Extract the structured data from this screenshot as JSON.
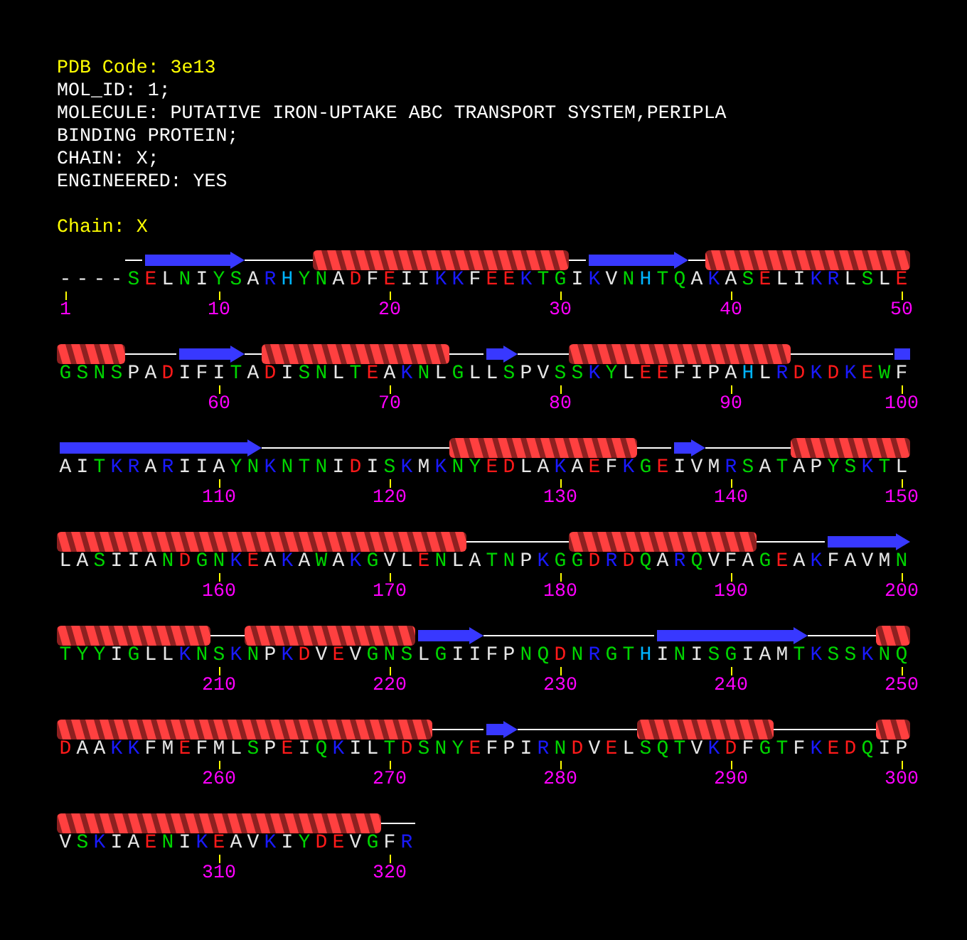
{
  "pdb_code": "PDB Code: 3e13",
  "header_lines": [
    "MOL_ID: 1;",
    "MOLECULE: PUTATIVE IRON-UPTAKE ABC TRANSPORT SYSTEM,PERIPLA",
    "BINDING PROTEIN;",
    "CHAIN: X;",
    "ENGINEERED: YES"
  ],
  "chain_label": "Chain: X",
  "rows": [
    {
      "segments": [
        {
          "kind": "none",
          "residues": [
            {
              "letter": "-",
              "color": "#e6e6e6",
              "number": "1"
            },
            {
              "letter": "-",
              "color": "#e6e6e6"
            },
            {
              "letter": "-",
              "color": "#e6e6e6"
            },
            {
              "letter": "-",
              "color": "#e6e6e6"
            }
          ]
        },
        {
          "kind": "coil",
          "residues": [
            {
              "letter": "S",
              "color": "#00d400"
            }
          ]
        },
        {
          "kind": "strand",
          "residues": [
            {
              "letter": "E",
              "color": "#ff1a1a"
            },
            {
              "letter": "L",
              "color": "#e6e6e6"
            },
            {
              "letter": "N",
              "color": "#00d400"
            },
            {
              "letter": "I",
              "color": "#e6e6e6"
            },
            {
              "letter": "Y",
              "color": "#00d400",
              "number": "10"
            },
            {
              "letter": "S",
              "color": "#00d400"
            }
          ]
        },
        {
          "kind": "coil",
          "residues": [
            {
              "letter": "A",
              "color": "#e6e6e6"
            },
            {
              "letter": "R",
              "color": "#1a1aff"
            },
            {
              "letter": "H",
              "color": "#00b4ff"
            },
            {
              "letter": "Y",
              "color": "#00d400"
            }
          ]
        },
        {
          "kind": "helix",
          "residues": [
            {
              "letter": "N",
              "color": "#00d400"
            },
            {
              "letter": "A",
              "color": "#e6e6e6"
            },
            {
              "letter": "D",
              "color": "#ff1a1a"
            },
            {
              "letter": "F",
              "color": "#e6e6e6"
            },
            {
              "letter": "E",
              "color": "#ff1a1a",
              "number": "20"
            },
            {
              "letter": "I",
              "color": "#e6e6e6"
            },
            {
              "letter": "I",
              "color": "#e6e6e6"
            },
            {
              "letter": "K",
              "color": "#1a1aff"
            },
            {
              "letter": "K",
              "color": "#1a1aff"
            },
            {
              "letter": "F",
              "color": "#e6e6e6"
            },
            {
              "letter": "E",
              "color": "#ff1a1a"
            },
            {
              "letter": "E",
              "color": "#ff1a1a"
            },
            {
              "letter": "K",
              "color": "#1a1aff"
            },
            {
              "letter": "T",
              "color": "#00d400"
            },
            {
              "letter": "G",
              "color": "#00d400",
              "number": "30"
            }
          ]
        },
        {
          "kind": "coil",
          "residues": [
            {
              "letter": "I",
              "color": "#e6e6e6"
            }
          ]
        },
        {
          "kind": "strand",
          "residues": [
            {
              "letter": "K",
              "color": "#1a1aff"
            },
            {
              "letter": "V",
              "color": "#e6e6e6"
            },
            {
              "letter": "N",
              "color": "#00d400"
            },
            {
              "letter": "H",
              "color": "#00b4ff"
            },
            {
              "letter": "T",
              "color": "#00d400"
            },
            {
              "letter": "Q",
              "color": "#00d400"
            }
          ]
        },
        {
          "kind": "coil",
          "residues": [
            {
              "letter": "A",
              "color": "#e6e6e6"
            }
          ]
        },
        {
          "kind": "helix",
          "residues": [
            {
              "letter": "K",
              "color": "#1a1aff"
            },
            {
              "letter": "A",
              "color": "#e6e6e6",
              "number": "40"
            },
            {
              "letter": "S",
              "color": "#00d400"
            },
            {
              "letter": "E",
              "color": "#ff1a1a"
            },
            {
              "letter": "L",
              "color": "#e6e6e6"
            },
            {
              "letter": "I",
              "color": "#e6e6e6"
            },
            {
              "letter": "K",
              "color": "#1a1aff"
            },
            {
              "letter": "R",
              "color": "#1a1aff"
            },
            {
              "letter": "L",
              "color": "#e6e6e6"
            },
            {
              "letter": "S",
              "color": "#00d400"
            },
            {
              "letter": "L",
              "color": "#e6e6e6"
            },
            {
              "letter": "E",
              "color": "#ff1a1a",
              "number": "50"
            }
          ]
        }
      ]
    },
    {
      "segments": [
        {
          "kind": "helix",
          "residues": [
            {
              "letter": "G",
              "color": "#00d400"
            },
            {
              "letter": "S",
              "color": "#00d400"
            },
            {
              "letter": "N",
              "color": "#00d400"
            },
            {
              "letter": "S",
              "color": "#00d400"
            }
          ]
        },
        {
          "kind": "coil",
          "residues": [
            {
              "letter": "P",
              "color": "#e6e6e6"
            },
            {
              "letter": "A",
              "color": "#e6e6e6"
            },
            {
              "letter": "D",
              "color": "#ff1a1a"
            }
          ]
        },
        {
          "kind": "strand",
          "residues": [
            {
              "letter": "I",
              "color": "#e6e6e6"
            },
            {
              "letter": "F",
              "color": "#e6e6e6"
            },
            {
              "letter": "I",
              "color": "#e6e6e6",
              "number": "60"
            },
            {
              "letter": "T",
              "color": "#00d400"
            }
          ]
        },
        {
          "kind": "coil",
          "residues": [
            {
              "letter": "A",
              "color": "#e6e6e6"
            }
          ]
        },
        {
          "kind": "helix",
          "residues": [
            {
              "letter": "D",
              "color": "#ff1a1a"
            },
            {
              "letter": "I",
              "color": "#e6e6e6"
            },
            {
              "letter": "S",
              "color": "#00d400"
            },
            {
              "letter": "N",
              "color": "#00d400"
            },
            {
              "letter": "L",
              "color": "#e6e6e6"
            },
            {
              "letter": "T",
              "color": "#00d400"
            },
            {
              "letter": "E",
              "color": "#ff1a1a"
            },
            {
              "letter": "A",
              "color": "#e6e6e6",
              "number": "70"
            },
            {
              "letter": "K",
              "color": "#1a1aff"
            },
            {
              "letter": "N",
              "color": "#00d400"
            },
            {
              "letter": "L",
              "color": "#e6e6e6"
            }
          ]
        },
        {
          "kind": "coil",
          "residues": [
            {
              "letter": "G",
              "color": "#00d400"
            },
            {
              "letter": "L",
              "color": "#e6e6e6"
            }
          ]
        },
        {
          "kind": "strand",
          "residues": [
            {
              "letter": "L",
              "color": "#e6e6e6"
            },
            {
              "letter": "S",
              "color": "#00d400"
            }
          ]
        },
        {
          "kind": "coil",
          "residues": [
            {
              "letter": "P",
              "color": "#e6e6e6"
            },
            {
              "letter": "V",
              "color": "#e6e6e6"
            },
            {
              "letter": "S",
              "color": "#00d400",
              "number": "80"
            }
          ]
        },
        {
          "kind": "helix",
          "residues": [
            {
              "letter": "S",
              "color": "#00d400"
            },
            {
              "letter": "K",
              "color": "#1a1aff"
            },
            {
              "letter": "Y",
              "color": "#00d400"
            },
            {
              "letter": "L",
              "color": "#e6e6e6"
            },
            {
              "letter": "E",
              "color": "#ff1a1a"
            },
            {
              "letter": "E",
              "color": "#ff1a1a"
            },
            {
              "letter": "F",
              "color": "#e6e6e6"
            },
            {
              "letter": "I",
              "color": "#e6e6e6"
            },
            {
              "letter": "P",
              "color": "#e6e6e6"
            },
            {
              "letter": "A",
              "color": "#e6e6e6",
              "number": "90"
            },
            {
              "letter": "H",
              "color": "#00b4ff"
            },
            {
              "letter": "L",
              "color": "#e6e6e6"
            },
            {
              "letter": "R",
              "color": "#1a1aff"
            }
          ]
        },
        {
          "kind": "coil",
          "residues": [
            {
              "letter": "D",
              "color": "#ff1a1a"
            },
            {
              "letter": "K",
              "color": "#1a1aff"
            },
            {
              "letter": "D",
              "color": "#ff1a1a"
            },
            {
              "letter": "K",
              "color": "#1a1aff"
            },
            {
              "letter": "E",
              "color": "#ff1a1a"
            },
            {
              "letter": "W",
              "color": "#00d400"
            }
          ]
        },
        {
          "kind": "strand",
          "residues": [
            {
              "letter": "F",
              "color": "#e6e6e6",
              "number": "100"
            }
          ]
        }
      ]
    },
    {
      "segments": [
        {
          "kind": "strand",
          "residues": [
            {
              "letter": "A",
              "color": "#e6e6e6"
            },
            {
              "letter": "I",
              "color": "#e6e6e6"
            },
            {
              "letter": "T",
              "color": "#00d400"
            },
            {
              "letter": "K",
              "color": "#1a1aff"
            },
            {
              "letter": "R",
              "color": "#1a1aff"
            },
            {
              "letter": "A",
              "color": "#e6e6e6"
            },
            {
              "letter": "R",
              "color": "#1a1aff"
            },
            {
              "letter": "I",
              "color": "#e6e6e6"
            },
            {
              "letter": "I",
              "color": "#e6e6e6"
            },
            {
              "letter": "A",
              "color": "#e6e6e6",
              "number": "110"
            },
            {
              "letter": "Y",
              "color": "#00d400"
            },
            {
              "letter": "N",
              "color": "#00d400"
            }
          ]
        },
        {
          "kind": "coil",
          "residues": [
            {
              "letter": "K",
              "color": "#1a1aff"
            },
            {
              "letter": "N",
              "color": "#00d400"
            },
            {
              "letter": "T",
              "color": "#00d400"
            },
            {
              "letter": "N",
              "color": "#00d400"
            },
            {
              "letter": "I",
              "color": "#e6e6e6"
            },
            {
              "letter": "D",
              "color": "#ff1a1a"
            },
            {
              "letter": "I",
              "color": "#e6e6e6"
            },
            {
              "letter": "S",
              "color": "#00d400",
              "number": "120"
            },
            {
              "letter": "K",
              "color": "#1a1aff"
            },
            {
              "letter": "M",
              "color": "#e6e6e6"
            },
            {
              "letter": "K",
              "color": "#1a1aff"
            }
          ]
        },
        {
          "kind": "helix",
          "residues": [
            {
              "letter": "N",
              "color": "#00d400"
            },
            {
              "letter": "Y",
              "color": "#00d400"
            },
            {
              "letter": "E",
              "color": "#ff1a1a"
            },
            {
              "letter": "D",
              "color": "#ff1a1a"
            },
            {
              "letter": "L",
              "color": "#e6e6e6"
            },
            {
              "letter": "A",
              "color": "#e6e6e6"
            },
            {
              "letter": "K",
              "color": "#1a1aff",
              "number": "130"
            },
            {
              "letter": "A",
              "color": "#e6e6e6"
            },
            {
              "letter": "E",
              "color": "#ff1a1a"
            },
            {
              "letter": "F",
              "color": "#e6e6e6"
            },
            {
              "letter": "K",
              "color": "#1a1aff"
            }
          ]
        },
        {
          "kind": "coil",
          "residues": [
            {
              "letter": "G",
              "color": "#00d400"
            },
            {
              "letter": "E",
              "color": "#ff1a1a"
            }
          ]
        },
        {
          "kind": "strand",
          "residues": [
            {
              "letter": "I",
              "color": "#e6e6e6"
            },
            {
              "letter": "V",
              "color": "#e6e6e6"
            }
          ]
        },
        {
          "kind": "coil",
          "residues": [
            {
              "letter": "M",
              "color": "#e6e6e6"
            },
            {
              "letter": "R",
              "color": "#1a1aff",
              "number": "140"
            },
            {
              "letter": "S",
              "color": "#00d400"
            },
            {
              "letter": "A",
              "color": "#e6e6e6"
            },
            {
              "letter": "T",
              "color": "#00d400"
            }
          ]
        },
        {
          "kind": "helix",
          "residues": [
            {
              "letter": "A",
              "color": "#e6e6e6"
            },
            {
              "letter": "P",
              "color": "#e6e6e6"
            },
            {
              "letter": "Y",
              "color": "#00d400"
            },
            {
              "letter": "S",
              "color": "#00d400"
            },
            {
              "letter": "K",
              "color": "#1a1aff"
            },
            {
              "letter": "T",
              "color": "#00d400"
            },
            {
              "letter": "L",
              "color": "#e6e6e6",
              "number": "150"
            }
          ]
        }
      ]
    },
    {
      "segments": [
        {
          "kind": "helix",
          "residues": [
            {
              "letter": "L",
              "color": "#e6e6e6"
            },
            {
              "letter": "A",
              "color": "#e6e6e6"
            },
            {
              "letter": "S",
              "color": "#00d400"
            },
            {
              "letter": "I",
              "color": "#e6e6e6"
            },
            {
              "letter": "I",
              "color": "#e6e6e6"
            },
            {
              "letter": "A",
              "color": "#e6e6e6"
            },
            {
              "letter": "N",
              "color": "#00d400"
            },
            {
              "letter": "D",
              "color": "#ff1a1a"
            },
            {
              "letter": "G",
              "color": "#00d400"
            },
            {
              "letter": "N",
              "color": "#00d400",
              "number": "160"
            },
            {
              "letter": "K",
              "color": "#1a1aff"
            },
            {
              "letter": "E",
              "color": "#ff1a1a"
            },
            {
              "letter": "A",
              "color": "#e6e6e6"
            },
            {
              "letter": "K",
              "color": "#1a1aff"
            },
            {
              "letter": "A",
              "color": "#e6e6e6"
            },
            {
              "letter": "W",
              "color": "#00d400"
            },
            {
              "letter": "A",
              "color": "#e6e6e6"
            },
            {
              "letter": "K",
              "color": "#1a1aff"
            },
            {
              "letter": "G",
              "color": "#00d400"
            },
            {
              "letter": "V",
              "color": "#e6e6e6",
              "number": "170"
            },
            {
              "letter": "L",
              "color": "#e6e6e6"
            },
            {
              "letter": "E",
              "color": "#ff1a1a"
            },
            {
              "letter": "N",
              "color": "#00d400"
            },
            {
              "letter": "L",
              "color": "#e6e6e6"
            }
          ]
        },
        {
          "kind": "coil",
          "residues": [
            {
              "letter": "A",
              "color": "#e6e6e6"
            },
            {
              "letter": "T",
              "color": "#00d400"
            },
            {
              "letter": "N",
              "color": "#00d400"
            },
            {
              "letter": "P",
              "color": "#e6e6e6"
            },
            {
              "letter": "K",
              "color": "#1a1aff"
            },
            {
              "letter": "G",
              "color": "#00d400",
              "number": "180"
            }
          ]
        },
        {
          "kind": "helix",
          "residues": [
            {
              "letter": "G",
              "color": "#00d400"
            },
            {
              "letter": "D",
              "color": "#ff1a1a"
            },
            {
              "letter": "R",
              "color": "#1a1aff"
            },
            {
              "letter": "D",
              "color": "#ff1a1a"
            },
            {
              "letter": "Q",
              "color": "#00d400"
            },
            {
              "letter": "A",
              "color": "#e6e6e6"
            },
            {
              "letter": "R",
              "color": "#1a1aff"
            },
            {
              "letter": "Q",
              "color": "#00d400"
            },
            {
              "letter": "V",
              "color": "#e6e6e6"
            },
            {
              "letter": "F",
              "color": "#e6e6e6",
              "number": "190"
            },
            {
              "letter": "A",
              "color": "#e6e6e6"
            }
          ]
        },
        {
          "kind": "coil",
          "residues": [
            {
              "letter": "G",
              "color": "#00d400"
            },
            {
              "letter": "E",
              "color": "#ff1a1a"
            },
            {
              "letter": "A",
              "color": "#e6e6e6"
            },
            {
              "letter": "K",
              "color": "#1a1aff"
            }
          ]
        },
        {
          "kind": "strand",
          "residues": [
            {
              "letter": "F",
              "color": "#e6e6e6"
            },
            {
              "letter": "A",
              "color": "#e6e6e6"
            },
            {
              "letter": "V",
              "color": "#e6e6e6"
            },
            {
              "letter": "M",
              "color": "#e6e6e6"
            },
            {
              "letter": "N",
              "color": "#00d400",
              "number": "200"
            }
          ]
        }
      ]
    },
    {
      "segments": [
        {
          "kind": "helix",
          "residues": [
            {
              "letter": "T",
              "color": "#00d400"
            },
            {
              "letter": "Y",
              "color": "#00d400"
            },
            {
              "letter": "Y",
              "color": "#00d400"
            },
            {
              "letter": "I",
              "color": "#e6e6e6"
            },
            {
              "letter": "G",
              "color": "#00d400"
            },
            {
              "letter": "L",
              "color": "#e6e6e6"
            },
            {
              "letter": "L",
              "color": "#e6e6e6"
            },
            {
              "letter": "K",
              "color": "#1a1aff"
            },
            {
              "letter": "N",
              "color": "#00d400"
            }
          ]
        },
        {
          "kind": "coil",
          "residues": [
            {
              "letter": "S",
              "color": "#00d400",
              "number": "210"
            },
            {
              "letter": "K",
              "color": "#1a1aff"
            }
          ]
        },
        {
          "kind": "helix",
          "residues": [
            {
              "letter": "N",
              "color": "#00d400"
            },
            {
              "letter": "P",
              "color": "#e6e6e6"
            },
            {
              "letter": "K",
              "color": "#1a1aff"
            },
            {
              "letter": "D",
              "color": "#ff1a1a"
            },
            {
              "letter": "V",
              "color": "#e6e6e6"
            },
            {
              "letter": "E",
              "color": "#ff1a1a"
            },
            {
              "letter": "V",
              "color": "#e6e6e6"
            },
            {
              "letter": "G",
              "color": "#00d400"
            },
            {
              "letter": "N",
              "color": "#00d400",
              "number": "220"
            },
            {
              "letter": "S",
              "color": "#00d400"
            }
          ]
        },
        {
          "kind": "strand",
          "residues": [
            {
              "letter": "L",
              "color": "#e6e6e6"
            },
            {
              "letter": "G",
              "color": "#00d400"
            },
            {
              "letter": "I",
              "color": "#e6e6e6"
            },
            {
              "letter": "I",
              "color": "#e6e6e6"
            }
          ]
        },
        {
          "kind": "coil",
          "residues": [
            {
              "letter": "F",
              "color": "#e6e6e6"
            },
            {
              "letter": "P",
              "color": "#e6e6e6"
            },
            {
              "letter": "N",
              "color": "#00d400"
            },
            {
              "letter": "Q",
              "color": "#00d400"
            },
            {
              "letter": "D",
              "color": "#ff1a1a",
              "number": "230"
            },
            {
              "letter": "N",
              "color": "#00d400"
            },
            {
              "letter": "R",
              "color": "#1a1aff"
            },
            {
              "letter": "G",
              "color": "#00d400"
            },
            {
              "letter": "T",
              "color": "#00d400"
            },
            {
              "letter": "H",
              "color": "#00b4ff"
            }
          ]
        },
        {
          "kind": "strand",
          "residues": [
            {
              "letter": "I",
              "color": "#e6e6e6"
            },
            {
              "letter": "N",
              "color": "#00d400"
            },
            {
              "letter": "I",
              "color": "#e6e6e6"
            },
            {
              "letter": "S",
              "color": "#00d400"
            },
            {
              "letter": "G",
              "color": "#00d400",
              "number": "240"
            },
            {
              "letter": "I",
              "color": "#e6e6e6"
            },
            {
              "letter": "A",
              "color": "#e6e6e6"
            },
            {
              "letter": "M",
              "color": "#e6e6e6"
            },
            {
              "letter": "T",
              "color": "#00d400"
            }
          ]
        },
        {
          "kind": "coil",
          "residues": [
            {
              "letter": "K",
              "color": "#1a1aff"
            },
            {
              "letter": "S",
              "color": "#00d400"
            },
            {
              "letter": "S",
              "color": "#00d400"
            },
            {
              "letter": "K",
              "color": "#1a1aff"
            }
          ]
        },
        {
          "kind": "helix",
          "residues": [
            {
              "letter": "N",
              "color": "#00d400"
            },
            {
              "letter": "Q",
              "color": "#00d400",
              "number": "250"
            }
          ]
        }
      ]
    },
    {
      "segments": [
        {
          "kind": "helix",
          "residues": [
            {
              "letter": "D",
              "color": "#ff1a1a"
            },
            {
              "letter": "A",
              "color": "#e6e6e6"
            },
            {
              "letter": "A",
              "color": "#e6e6e6"
            },
            {
              "letter": "K",
              "color": "#1a1aff"
            },
            {
              "letter": "K",
              "color": "#1a1aff"
            },
            {
              "letter": "F",
              "color": "#e6e6e6"
            },
            {
              "letter": "M",
              "color": "#e6e6e6"
            },
            {
              "letter": "E",
              "color": "#ff1a1a"
            },
            {
              "letter": "F",
              "color": "#e6e6e6"
            },
            {
              "letter": "M",
              "color": "#e6e6e6",
              "number": "260"
            },
            {
              "letter": "L",
              "color": "#e6e6e6"
            },
            {
              "letter": "S",
              "color": "#00d400"
            },
            {
              "letter": "P",
              "color": "#e6e6e6"
            },
            {
              "letter": "E",
              "color": "#ff1a1a"
            },
            {
              "letter": "I",
              "color": "#e6e6e6"
            },
            {
              "letter": "Q",
              "color": "#00d400"
            },
            {
              "letter": "K",
              "color": "#1a1aff"
            },
            {
              "letter": "I",
              "color": "#e6e6e6"
            },
            {
              "letter": "L",
              "color": "#e6e6e6"
            },
            {
              "letter": "T",
              "color": "#00d400",
              "number": "270"
            },
            {
              "letter": "D",
              "color": "#ff1a1a"
            },
            {
              "letter": "S",
              "color": "#00d400"
            }
          ]
        },
        {
          "kind": "coil",
          "residues": [
            {
              "letter": "N",
              "color": "#00d400"
            },
            {
              "letter": "Y",
              "color": "#00d400"
            },
            {
              "letter": "E",
              "color": "#ff1a1a"
            }
          ]
        },
        {
          "kind": "strand",
          "residues": [
            {
              "letter": "F",
              "color": "#e6e6e6"
            },
            {
              "letter": "P",
              "color": "#e6e6e6"
            }
          ]
        },
        {
          "kind": "coil",
          "residues": [
            {
              "letter": "I",
              "color": "#e6e6e6"
            },
            {
              "letter": "R",
              "color": "#1a1aff"
            },
            {
              "letter": "N",
              "color": "#00d400",
              "number": "280"
            },
            {
              "letter": "D",
              "color": "#ff1a1a"
            },
            {
              "letter": "V",
              "color": "#e6e6e6"
            },
            {
              "letter": "E",
              "color": "#ff1a1a"
            },
            {
              "letter": "L",
              "color": "#e6e6e6"
            }
          ]
        },
        {
          "kind": "helix",
          "residues": [
            {
              "letter": "S",
              "color": "#00d400"
            },
            {
              "letter": "Q",
              "color": "#00d400"
            },
            {
              "letter": "T",
              "color": "#00d400"
            },
            {
              "letter": "V",
              "color": "#e6e6e6"
            },
            {
              "letter": "K",
              "color": "#1a1aff"
            },
            {
              "letter": "D",
              "color": "#ff1a1a",
              "number": "290"
            },
            {
              "letter": "F",
              "color": "#e6e6e6"
            },
            {
              "letter": "G",
              "color": "#00d400"
            }
          ]
        },
        {
          "kind": "coil",
          "residues": [
            {
              "letter": "T",
              "color": "#00d400"
            },
            {
              "letter": "F",
              "color": "#e6e6e6"
            },
            {
              "letter": "K",
              "color": "#1a1aff"
            },
            {
              "letter": "E",
              "color": "#ff1a1a"
            },
            {
              "letter": "D",
              "color": "#ff1a1a"
            },
            {
              "letter": "Q",
              "color": "#00d400"
            }
          ]
        },
        {
          "kind": "helix",
          "residues": [
            {
              "letter": "I",
              "color": "#e6e6e6"
            },
            {
              "letter": "P",
              "color": "#e6e6e6",
              "number": "300"
            }
          ]
        }
      ]
    },
    {
      "segments": [
        {
          "kind": "helix",
          "residues": [
            {
              "letter": "V",
              "color": "#e6e6e6"
            },
            {
              "letter": "S",
              "color": "#00d400"
            },
            {
              "letter": "K",
              "color": "#1a1aff"
            },
            {
              "letter": "I",
              "color": "#e6e6e6"
            },
            {
              "letter": "A",
              "color": "#e6e6e6"
            },
            {
              "letter": "E",
              "color": "#ff1a1a"
            },
            {
              "letter": "N",
              "color": "#00d400"
            },
            {
              "letter": "I",
              "color": "#e6e6e6"
            },
            {
              "letter": "K",
              "color": "#1a1aff"
            },
            {
              "letter": "E",
              "color": "#ff1a1a",
              "number": "310"
            },
            {
              "letter": "A",
              "color": "#e6e6e6"
            },
            {
              "letter": "V",
              "color": "#e6e6e6"
            },
            {
              "letter": "K",
              "color": "#1a1aff"
            },
            {
              "letter": "I",
              "color": "#e6e6e6"
            },
            {
              "letter": "Y",
              "color": "#00d400"
            },
            {
              "letter": "D",
              "color": "#ff1a1a"
            },
            {
              "letter": "E",
              "color": "#ff1a1a"
            },
            {
              "letter": "V",
              "color": "#e6e6e6"
            },
            {
              "letter": "G",
              "color": "#00d400"
            }
          ]
        },
        {
          "kind": "coil",
          "residues": [
            {
              "letter": "F",
              "color": "#e6e6e6",
              "number": "320"
            },
            {
              "letter": "R",
              "color": "#1a1aff"
            }
          ]
        }
      ]
    }
  ]
}
